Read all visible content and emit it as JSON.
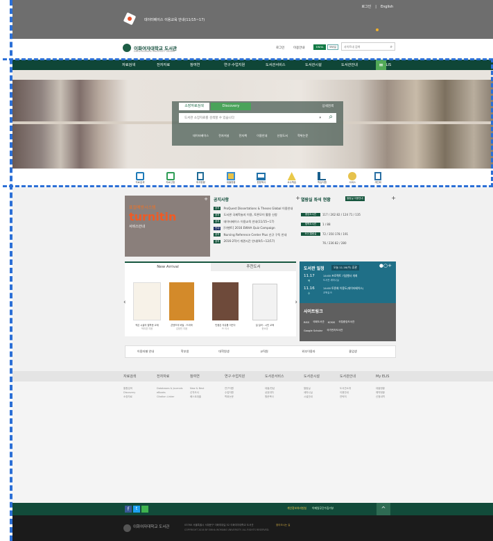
{
  "topbar": {
    "links": [
      "로그인",
      "모바일",
      "English"
    ],
    "notice": "데이터베이스 이용교육 안내(11/15~17)"
  },
  "brand": {
    "name": "이화여자대학교 도서관",
    "sub": "EWHA WOMANS UNIVERSITY LIBRARY",
    "search_placeholder": "사이트내 검색",
    "util": [
      "로그인",
      "이용안내"
    ]
  },
  "nav": [
    "자료검색",
    "전자자료",
    "참여연",
    "연구·수업지원",
    "도서관서비스",
    "도서관시설",
    "도서관안내",
    "My ELIS"
  ],
  "hero": {
    "tab_active": "소장자료검색",
    "tab_other": "Discovery",
    "detail": "상세검색",
    "placeholder": "도서관 소장자료를 검색할 수 있습니다",
    "sublinks": [
      "데이터베이스",
      "전자저널",
      "전자책",
      "이용안내",
      "신청도서",
      "학위논문"
    ]
  },
  "quick": [
    "자료검색",
    "자료신청",
    "좌석현황",
    "대출현황",
    "원문복사",
    "교수학습",
    "학습지원",
    "서비스",
    "개인화"
  ],
  "notices": {
    "title": "공지사항",
    "items": [
      {
        "tag": "공지",
        "text": "ProQuest Dissertations & Theses Global 이용안내"
      },
      {
        "tag": "공지",
        "text": "도서관 국제학술지 이용, 토론모이 활용 신청"
      },
      {
        "tag": "공지",
        "text": "데이터베이스 이용교육 안내(11/15~17)"
      },
      {
        "tag": "안내",
        "text": "[이벤트] 2016 EWHA Quiz Campaign"
      },
      {
        "tag": "공지",
        "text": "Nursing Reference Center Plus 신규 구독 안내"
      },
      {
        "tag": "공지",
        "text": "2016-2학기 개관시간 안내(9/1~12/17)"
      }
    ]
  },
  "turnitin": {
    "label": "표절예방시스템",
    "logo": "turnitin",
    "sub": "서비스안내"
  },
  "seats": {
    "title": "열람실 좌석 현황",
    "btn": "열람실 이용안내",
    "rows": [
      {
        "name": "중앙도서관",
        "v": "117 / 262   82 / 124   71 / 135"
      },
      {
        "name": "법학도서관",
        "v": "1 / 88"
      },
      {
        "name": "ECC열람실",
        "v": "72 / 350   178 / 191"
      },
      {
        "name": "",
        "v": "76 / 236   82 / 280"
      }
    ]
  },
  "books": {
    "tab_active": "New Arrival",
    "tab_other": "추천도서",
    "items": [
      {
        "title": "작은 시골의 철학한 교재",
        "author": "박미경 지음"
      },
      {
        "title": "콘텐츠의 비밀 : 드라마",
        "author": "김정민 지음"
      },
      {
        "title": "민중은 자유를 이끈다",
        "author": "Pl 이사"
      },
      {
        "title": "킬 킬러 :  시민 교육",
        "author": "한숙영"
      }
    ]
  },
  "schedule": {
    "title": "도서관 일정",
    "date": "오늘 11.16(수) 휴관",
    "rows": [
      {
        "d": "11.17",
        "w": "목",
        "t": "14:00 프로젝트 기념행사 개최",
        "s": "도서관 세미나실"
      },
      {
        "d": "11.16",
        "w": "수",
        "t": "14:00 토론회 이용도(데이터베이스)",
        "s": "교육실 B"
      }
    ]
  },
  "sitelinks": {
    "title": "사이트링크",
    "items": [
      "RISS",
      "국회도서관",
      "KOSIS",
      "국립중앙도서관",
      "Google Scholar",
      "국가전자도서관"
    ]
  },
  "tools": [
    "이용자별 안내",
    "학부생",
    "대학원생",
    "교직원",
    "외부이용자",
    "졸업생"
  ],
  "footer": {
    "cols": [
      {
        "h": "자료검색",
        "l": [
          "통합검색",
          "Discovery",
          "소장자료"
        ]
      },
      {
        "h": "전자자료",
        "l": [
          "Databases & Journals",
          "eBooks",
          "Citation Linker"
        ]
      },
      {
        "h": "참여연",
        "l": [
          "New & Best",
          "신착도서",
          "베스트대출"
        ]
      },
      {
        "h": "연구·수업지원",
        "l": [
          "연구지원",
          "수업지원",
          "학위논문"
        ]
      },
      {
        "h": "도서관서비스",
        "l": [
          "대출/반납",
          "상호대차",
          "원문복사"
        ]
      },
      {
        "h": "도서관시설",
        "l": [
          "열람실",
          "세미나실",
          "시설안내"
        ]
      },
      {
        "h": "도서관안내",
        "l": [
          "도서관소개",
          "이용안내",
          "연락처"
        ]
      },
      {
        "h": "My ELIS",
        "l": [
          "대출현황",
          "예약현황",
          "신청내역"
        ]
      }
    ]
  },
  "bottom": {
    "links": [
      "개인정보처리방침",
      "이메일무단수집거부",
      "찾아오시는 길"
    ],
    "name": "이화여자대학교 도서관",
    "addr": "03760 서울특별시 서대문구 이화여대길 52 이화여자대학교 도서관",
    "copy": "COPYRIGHT 2016 BY EWHA WOMANS UNIVERSITY. ALL RIGHTS RESERVED."
  }
}
